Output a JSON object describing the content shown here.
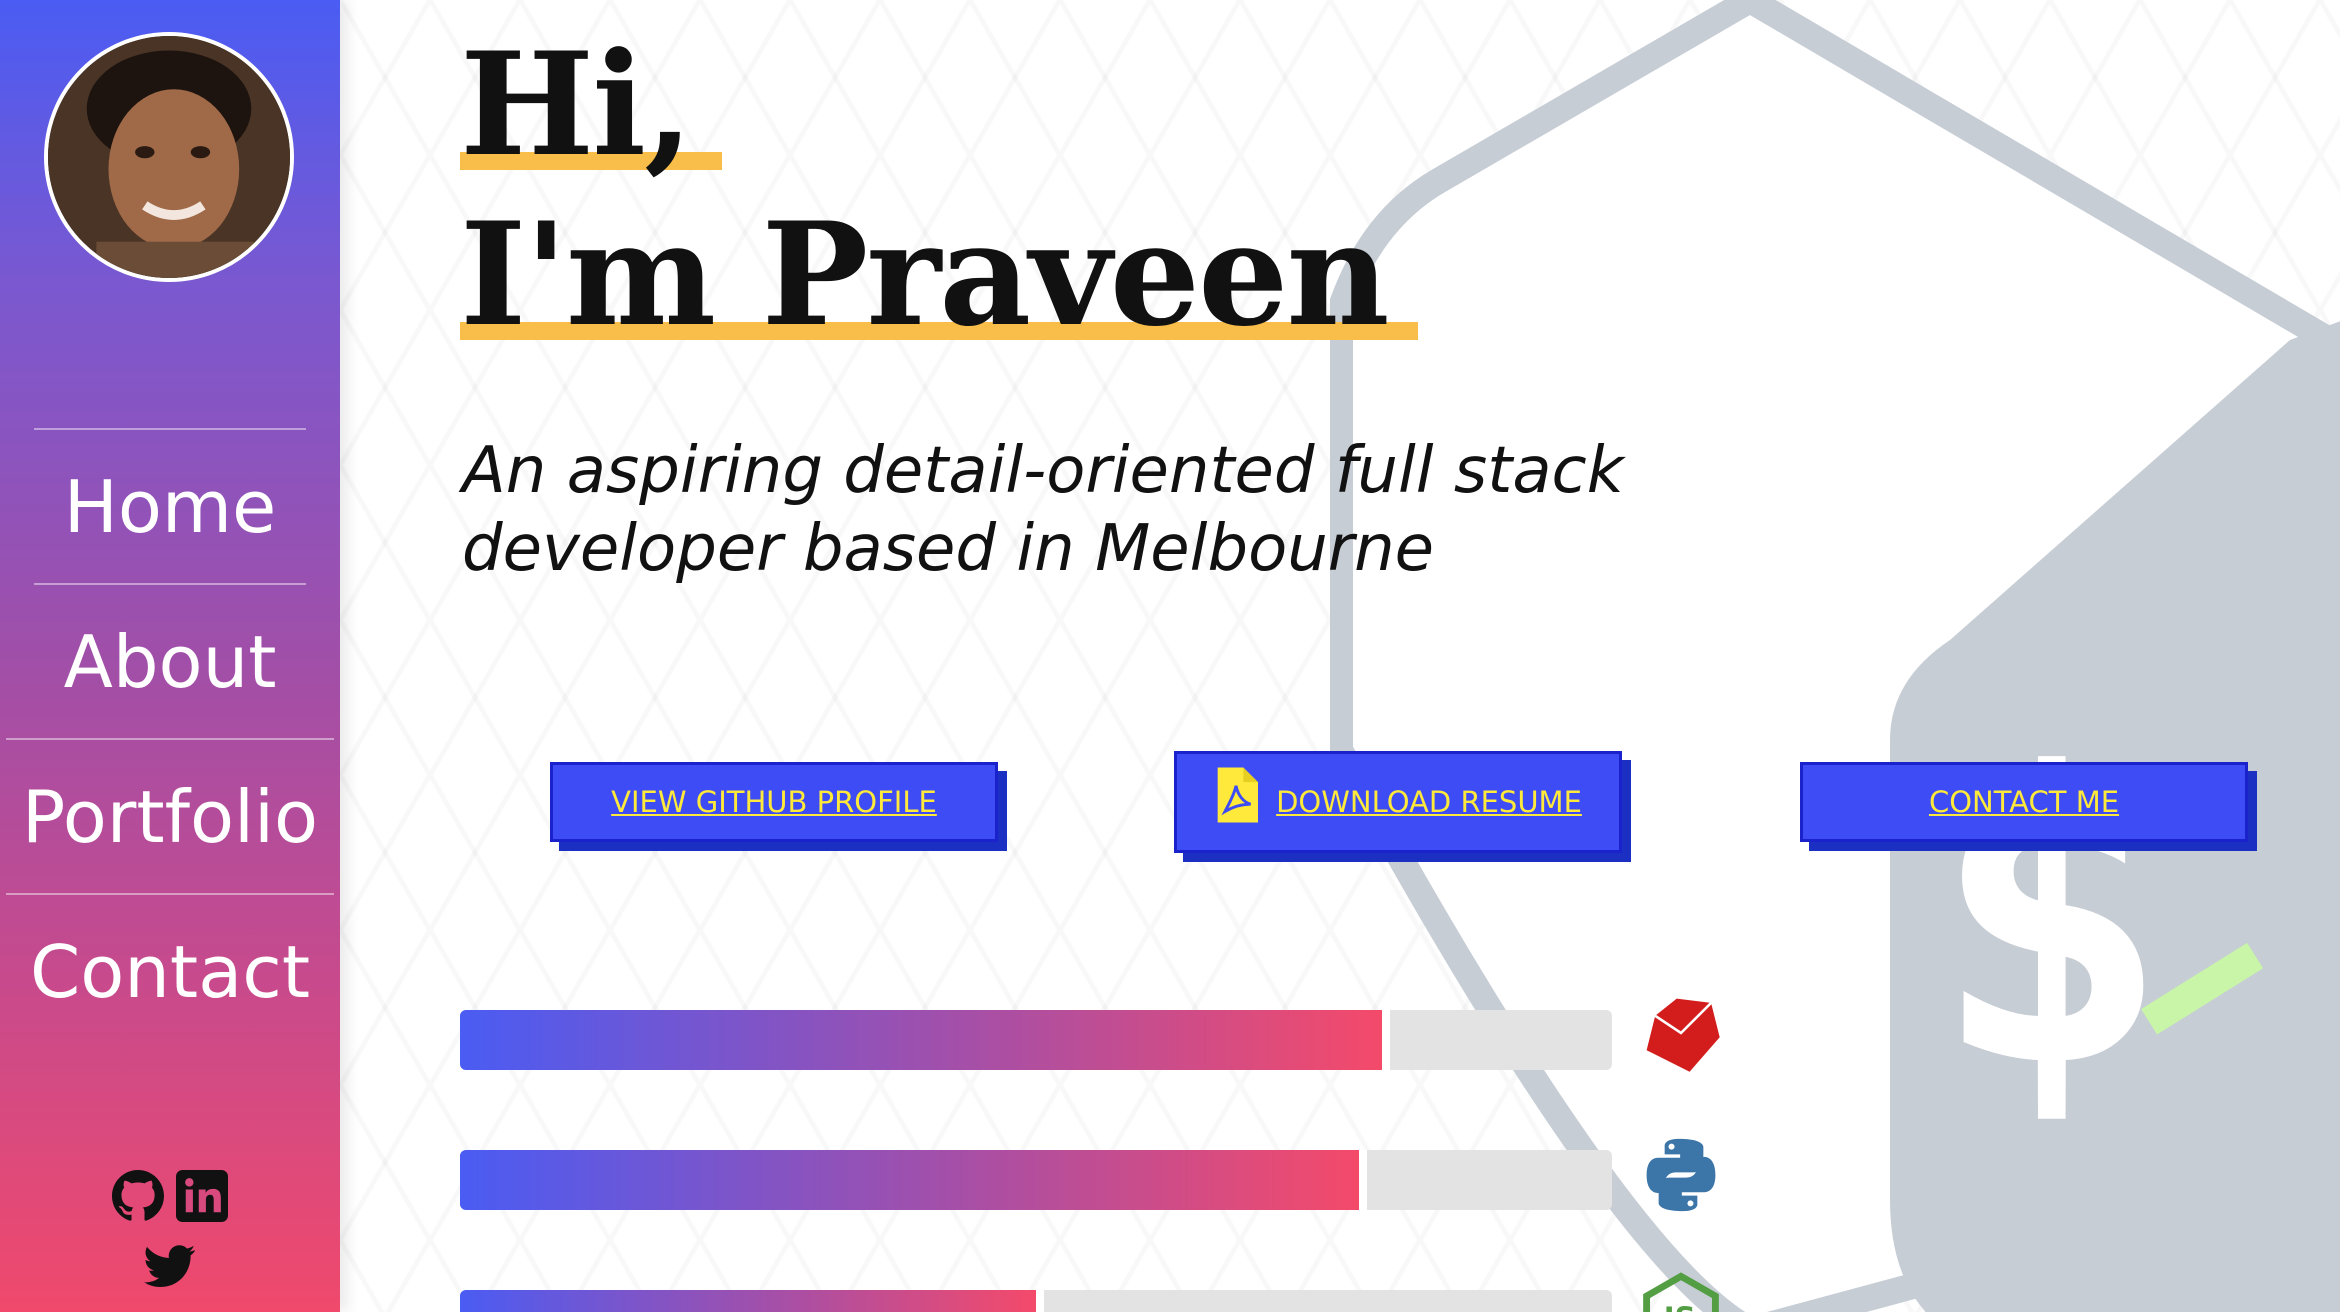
{
  "sidebar": {
    "avatar_alt": "Praveen profile photo",
    "nav": [
      {
        "label": "Home"
      },
      {
        "label": "About"
      },
      {
        "label": "Portfolio"
      },
      {
        "label": "Contact"
      }
    ],
    "socials": [
      "github-icon",
      "linkedin-icon",
      "twitter-icon"
    ]
  },
  "hero": {
    "greeting": "Hi,",
    "name_line": "I'm Praveen",
    "tagline_line1": "An aspiring detail-oriented full stack",
    "tagline_line2": "developer based in Melbourne"
  },
  "buttons": {
    "github": "VIEW GITHUB PROFILE",
    "resume": "DOWNLOAD RESUME",
    "contact": "CONTACT ME"
  },
  "skills": [
    {
      "icon": "ruby-icon",
      "level": 0.8
    },
    {
      "icon": "python-icon",
      "level": 0.78
    },
    {
      "icon": "nodejs-icon",
      "level": 0.5
    }
  ],
  "colors": {
    "sidebar_top": "#4a5cf3",
    "sidebar_bottom": "#f0496c",
    "button_bg": "#3d4cf5",
    "button_text": "#ffe93a",
    "highlight": "#f9bd4a"
  }
}
